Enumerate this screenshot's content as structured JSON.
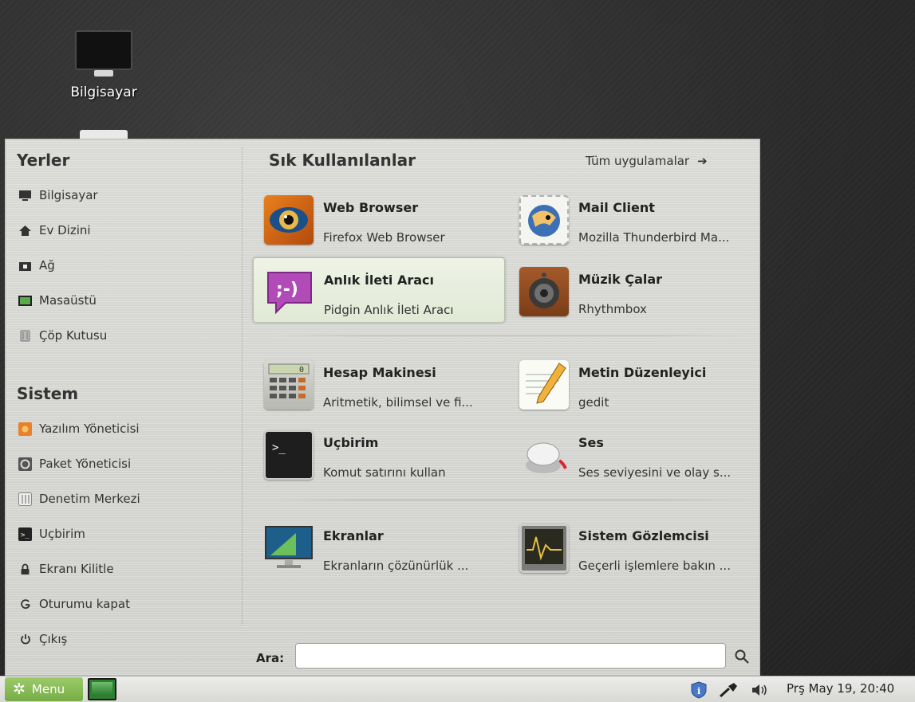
{
  "desktop": {
    "computer_label": "Bilgisayar"
  },
  "places": {
    "title": "Yerler",
    "items": [
      {
        "label": "Bilgisayar",
        "icon": "computer-icon"
      },
      {
        "label": "Ev Dizini",
        "icon": "home-icon"
      },
      {
        "label": "Ağ",
        "icon": "network-icon"
      },
      {
        "label": "Masaüstü",
        "icon": "desktop-icon"
      },
      {
        "label": "Çöp Kutusu",
        "icon": "trash-icon"
      }
    ]
  },
  "system": {
    "title": "Sistem",
    "items": [
      {
        "label": "Yazılım Yöneticisi",
        "icon": "software-manager-icon"
      },
      {
        "label": "Paket Yöneticisi",
        "icon": "package-manager-icon"
      },
      {
        "label": "Denetim Merkezi",
        "icon": "control-center-icon"
      },
      {
        "label": "Uçbirim",
        "icon": "terminal-icon"
      },
      {
        "label": "Ekranı Kilitle",
        "icon": "lock-icon"
      },
      {
        "label": "Oturumu kapat",
        "icon": "logout-icon"
      },
      {
        "label": "Çıkış",
        "icon": "power-icon"
      }
    ]
  },
  "favorites": {
    "title": "Sık Kullanılanlar",
    "all_apps_label": "Tüm uygulamalar",
    "apps": [
      {
        "name": "Web Browser",
        "desc": "Firefox Web Browser",
        "icon": "firefox-icon"
      },
      {
        "name": "Mail Client",
        "desc": "Mozilla Thunderbird Ma...",
        "icon": "thunderbird-icon"
      },
      {
        "name": "Anlık İleti Aracı",
        "desc": "Pidgin Anlık İleti Aracı",
        "icon": "pidgin-icon"
      },
      {
        "name": "Müzik Çalar",
        "desc": "Rhythmbox",
        "icon": "speaker-icon"
      },
      {
        "name": "Hesap Makinesi",
        "desc": "Aritmetik, bilimsel ve fi...",
        "icon": "calculator-icon"
      },
      {
        "name": "Metin Düzenleyici",
        "desc": "gedit",
        "icon": "text-editor-icon"
      },
      {
        "name": "Uçbirim",
        "desc": "Komut satırını kullan",
        "icon": "terminal-icon"
      },
      {
        "name": "Ses",
        "desc": "Ses seviyesini ve olay s...",
        "icon": "volume-knob-icon"
      },
      {
        "name": "Ekranlar",
        "desc": "Ekranların çözünürlük ...",
        "icon": "display-icon"
      },
      {
        "name": "Sistem Gözlemcisi",
        "desc": "Geçerli işlemlere bakın ...",
        "icon": "system-monitor-icon"
      }
    ]
  },
  "search": {
    "label": "Ara:",
    "value": "",
    "placeholder": ""
  },
  "panel": {
    "menu_label": "Menu",
    "clock": "Prş May 19, 20:40"
  },
  "calc_display": "0"
}
